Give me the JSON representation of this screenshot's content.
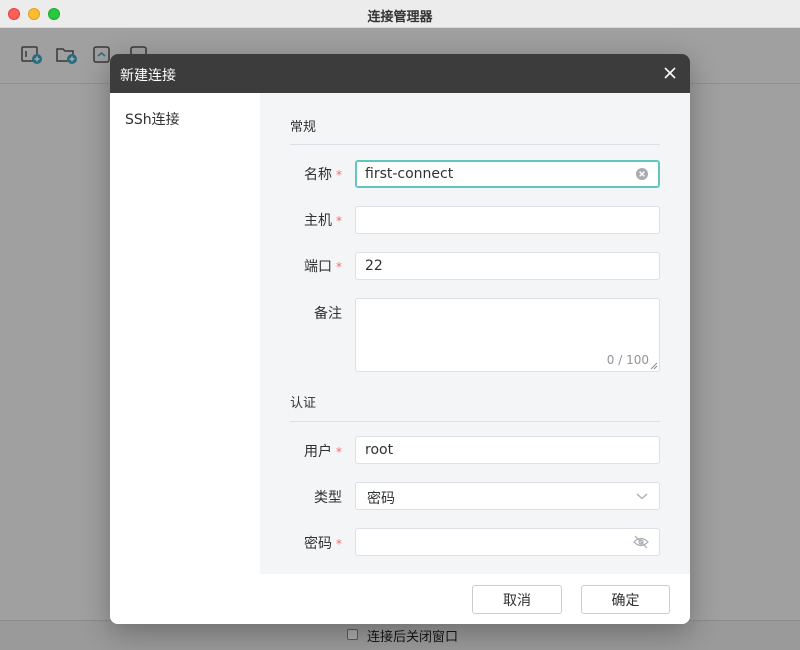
{
  "window": {
    "title": "连接管理器"
  },
  "toolbar": {
    "icons": [
      "new-connection-icon",
      "new-folder-icon",
      "import-icon",
      "export-icon"
    ]
  },
  "footer": {
    "close_after_connect_label": "连接后关闭窗口",
    "close_after_connect_checked": false
  },
  "dialog": {
    "title": "新建连接",
    "sidebar": {
      "items": [
        {
          "label": "SSh连接"
        }
      ]
    },
    "general": {
      "title": "常规",
      "name": {
        "label": "名称",
        "required": "*",
        "value": "first-connect"
      },
      "host": {
        "label": "主机",
        "required": "*",
        "value": ""
      },
      "port": {
        "label": "端口",
        "required": "*",
        "value": "22"
      },
      "note": {
        "label": "备注",
        "value": "",
        "counter": "0 / 100"
      }
    },
    "auth": {
      "title": "认证",
      "user": {
        "label": "用户",
        "required": "*",
        "value": "root"
      },
      "type": {
        "label": "类型",
        "value": "密码"
      },
      "password": {
        "label": "密码",
        "required": "*",
        "value": ""
      }
    },
    "buttons": {
      "cancel": "取消",
      "confirm": "确定"
    }
  },
  "colors": {
    "focus": "#5fc6c0",
    "required": "#f56c6c",
    "header": "#3c3c3c"
  }
}
